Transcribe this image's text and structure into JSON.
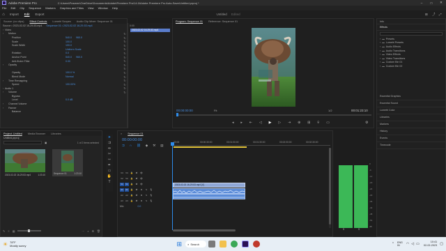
{
  "app": {
    "title": "Adobe Premiere Pro",
    "path": "C:\\Users\\Praveen\\OneDrive\\Documents\\Adobe\\Premiere Pro\\14.0\\Adobe Premiere Pro Auto-Save\\Untitled.prproj *"
  },
  "menu": [
    "File",
    "Edit",
    "Clip",
    "Sequence",
    "Markers",
    "Graphics and Titles",
    "View",
    "Window",
    "Help"
  ],
  "workspace": {
    "tabs": [
      "Import",
      "Edit",
      "Export"
    ],
    "active": "Edit",
    "center_label": "Untitled",
    "center_sub": "Edited"
  },
  "source_panel": {
    "tabs": [
      "Source: (no clips)",
      "Effect Controls",
      "Lumetri Scopes",
      "Audio Clip Mixer: Sequence 01",
      "Audio Track Mixer: Sequence"
    ],
    "active": "Effect Controls",
    "source_label": "Source • 2023-02-02 16-29-53.mp4",
    "sequence_label": "Sequence 01 • 2023-02-02 16-29-53.mp4",
    "mini_label": "0:00",
    "mini_clip": "2023-02-02 16-29-53.mp4",
    "rows": [
      {
        "label": "Video",
        "indent": 0,
        "v1": "",
        "v2": ""
      },
      {
        "label": "Motion",
        "indent": 1,
        "v1": "",
        "v2": ""
      },
      {
        "label": "Position",
        "indent": 2,
        "v1": "540.0",
        "v2": "960.0"
      },
      {
        "label": "Scale",
        "indent": 2,
        "v1": "100.0",
        "v2": ""
      },
      {
        "label": "Scale Width",
        "indent": 2,
        "v1": "100.0",
        "v2": ""
      },
      {
        "label": "",
        "indent": 2,
        "v1": "Uniform Scale",
        "v2": ""
      },
      {
        "label": "Rotation",
        "indent": 2,
        "v1": "0.0",
        "v2": ""
      },
      {
        "label": "Anchor Point",
        "indent": 2,
        "v1": "540.0",
        "v2": "960.0"
      },
      {
        "label": "Anti-flicker Filter",
        "indent": 2,
        "v1": "0.00",
        "v2": ""
      },
      {
        "label": "Opacity",
        "indent": 1,
        "v1": "",
        "v2": ""
      },
      {
        "label": "",
        "indent": 2,
        "v1": "",
        "v2": ""
      },
      {
        "label": "Opacity",
        "indent": 2,
        "v1": "100.0 %",
        "v2": ""
      },
      {
        "label": "Blend Mode",
        "indent": 2,
        "v1": "Normal",
        "v2": ""
      },
      {
        "label": "Time Remapping",
        "indent": 1,
        "v1": "",
        "v2": ""
      },
      {
        "label": "Speed",
        "indent": 2,
        "v1": "100.00%",
        "v2": ""
      },
      {
        "label": "Audio 1",
        "indent": 0,
        "v1": "",
        "v2": ""
      },
      {
        "label": "Volume",
        "indent": 1,
        "v1": "",
        "v2": ""
      },
      {
        "label": "Bypass",
        "indent": 2,
        "v1": "",
        "v2": ""
      },
      {
        "label": "Level",
        "indent": 2,
        "v1": "0.0 dB",
        "v2": ""
      },
      {
        "label": "Channel Volume",
        "indent": 1,
        "v1": "",
        "v2": ""
      },
      {
        "label": "Panner",
        "indent": 1,
        "v1": "",
        "v2": ""
      },
      {
        "label": "Balance",
        "indent": 2,
        "v1": "",
        "v2": ""
      }
    ]
  },
  "program_monitor": {
    "tabs": [
      "Program: Sequence 01",
      "Reference: Sequence 01"
    ],
    "timecode_left": "00:00:00:00",
    "fit": "Fit",
    "quality": "1/2",
    "timecode_right": "00:01:23:10",
    "controls": [
      "mark-in",
      "mark-out",
      "go-in",
      "step-back",
      "play",
      "step-forward",
      "go-out",
      "insert",
      "overwrite",
      "export-frame",
      "compare"
    ]
  },
  "right_panel": {
    "title": "Effects",
    "top_tab": "Info",
    "items": [
      "Presets",
      "Lumetri Presets",
      "Audio Effects",
      "Audio Transitions",
      "Video Effects",
      "Video Transitions",
      "Custom Bin 01",
      "Custom Bin 02"
    ],
    "sections": [
      "Essential Graphics",
      "Essential Sound",
      "Lumetri Color",
      "Libraries",
      "Markers",
      "History",
      "Events",
      "Timecode"
    ]
  },
  "project_panel": {
    "tabs": [
      "Project: Untitled",
      "Media Browser",
      "Libraries"
    ],
    "active": "Project: Untitled",
    "project_file": "Untitled.prproj",
    "selection": "1 of 2 items selected",
    "items": [
      {
        "name": "2023-02-02 16-29-53.mp4",
        "duration": "1:23:10"
      },
      {
        "name": "Sequence 01",
        "duration": "1:23:10"
      }
    ]
  },
  "timeline": {
    "tab": "Sequence 01",
    "timecode": "00:00:00:00",
    "ruler": [
      "00:00",
      "00:00:30:00",
      "00:01:00:00",
      "00:01:30:00",
      "00:02:00:00",
      "00:02:30:00"
    ],
    "video_tracks": [
      "V3",
      "V2",
      "V1"
    ],
    "audio_tracks": [
      "A1",
      "A2",
      "A3"
    ],
    "mix_label": "Mix",
    "mix_value": "0.0",
    "clip_label": "2023-02-02 16-29-53.mp4 [V]"
  },
  "meters": {
    "scale": [
      "0",
      "-6",
      "-12",
      "-18",
      "-24",
      "-30",
      "-36",
      "-42",
      "-48",
      "-54",
      "dB"
    ],
    "labels": [
      "S",
      "S"
    ]
  },
  "taskbar": {
    "weather_temp": "78°F",
    "weather_desc": "Mostly sunny",
    "search_label": "Search",
    "lang": "ENG",
    "region": "IN",
    "time": "10:41",
    "date": "02-02-2023"
  },
  "colors": {
    "accent": "#2d8ceb",
    "clip_audio": "#5a8bd8",
    "clip_video": "#8fa7d6",
    "meter": "#3cb857"
  }
}
